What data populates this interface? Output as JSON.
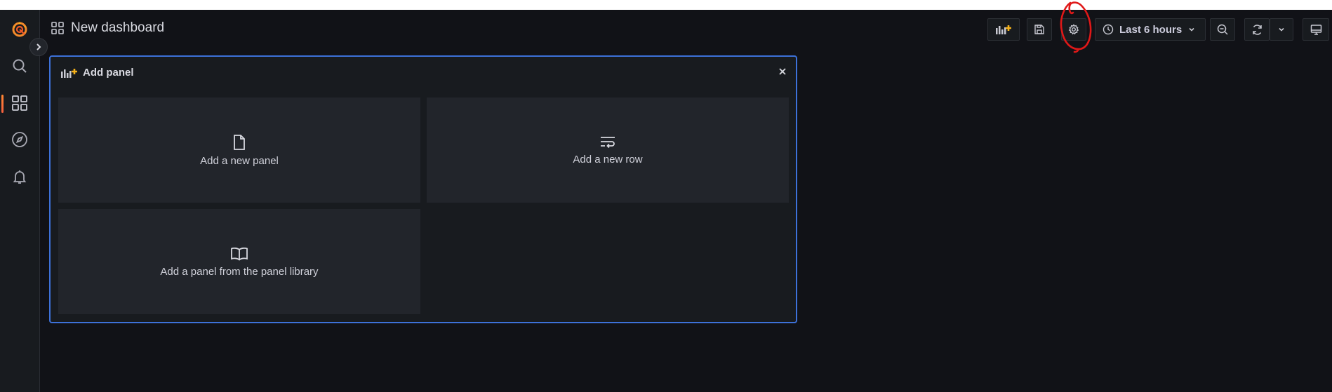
{
  "header": {
    "title": "New dashboard",
    "time_picker": {
      "label": "Last 6 hours"
    }
  },
  "sidebar": {
    "items": [
      {
        "name": "logo",
        "icon": "grafana-logo-icon"
      },
      {
        "name": "search",
        "icon": "search-icon"
      },
      {
        "name": "dashboards",
        "icon": "apps-icon",
        "active": true
      },
      {
        "name": "explore",
        "icon": "compass-icon"
      },
      {
        "name": "alerting",
        "icon": "bell-icon"
      }
    ]
  },
  "add_panel": {
    "title": "Add panel",
    "cards": [
      {
        "label": "Add a new panel",
        "icon": "file-icon"
      },
      {
        "label": "Add a new row",
        "icon": "wrap-text-icon"
      },
      {
        "label": "Add a panel from the panel library",
        "icon": "book-icon"
      }
    ]
  },
  "colors": {
    "background": "#111217",
    "sidebar": "#181b1f",
    "panel_border": "#3d71d9",
    "card": "#22252b",
    "brand": "#f05a28",
    "annotation": "#e01818"
  }
}
